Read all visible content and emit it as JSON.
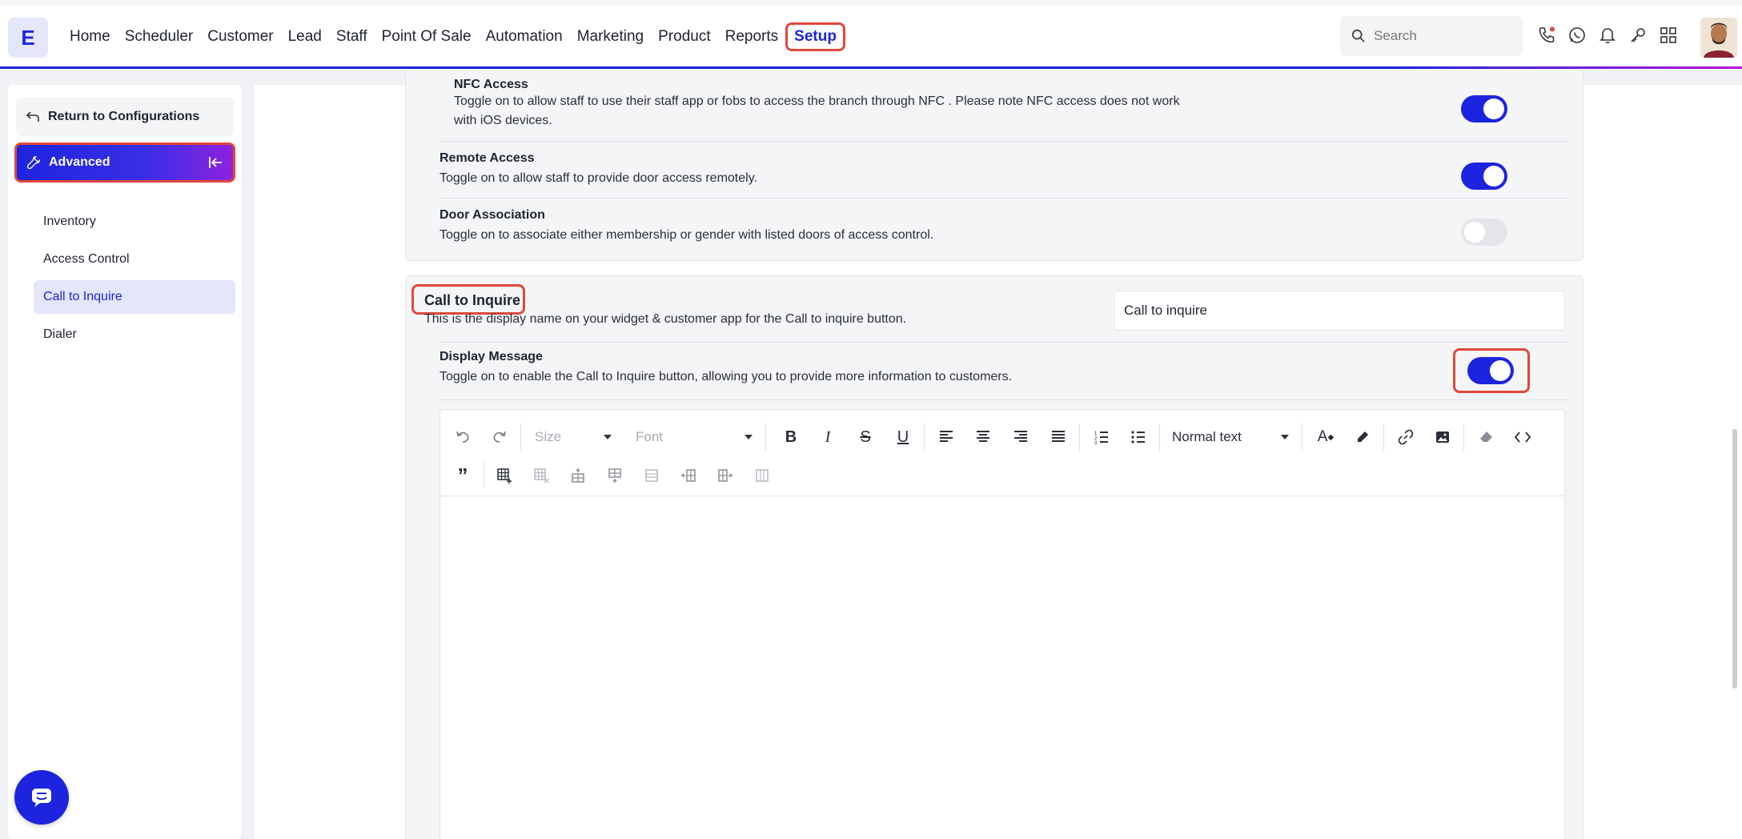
{
  "app": {
    "logo_letter": "E"
  },
  "nav": {
    "items": [
      "Home",
      "Scheduler",
      "Customer",
      "Lead",
      "Staff",
      "Point Of Sale",
      "Automation",
      "Marketing",
      "Product",
      "Reports",
      "Setup"
    ],
    "active": "Setup"
  },
  "search": {
    "placeholder": "Search"
  },
  "top_icons": [
    "phone-icon",
    "whatsapp-icon",
    "bell-icon",
    "key-icon",
    "apps-grid-icon"
  ],
  "colors": {
    "accent": "#1d24e0",
    "highlight": "#e0483a",
    "toggle_off": "#e4e5e9"
  },
  "sidebar": {
    "return_label": "Return to Configurations",
    "section_label": "Advanced",
    "items": [
      {
        "label": "Inventory",
        "active": false
      },
      {
        "label": "Access Control",
        "active": false
      },
      {
        "label": "Call to Inquire",
        "active": true
      },
      {
        "label": "Dialer",
        "active": false
      }
    ]
  },
  "access_control": {
    "nfc": {
      "title": "NFC Access",
      "desc_line1": "Toggle on to allow staff to use their staff app or fobs to access the branch through NFC . Please note NFC access does not work",
      "desc_line2": "with iOS devices.",
      "enabled": true
    },
    "remote": {
      "title": "Remote Access",
      "desc": "Toggle on to allow staff to provide door access remotely.",
      "enabled": true
    },
    "door": {
      "title": "Door Association",
      "desc": "Toggle on to associate either membership or gender with listed doors of access control.",
      "enabled": false
    }
  },
  "call_to_inquire": {
    "title": "Call to Inquire",
    "desc": "This is the display name on your widget & customer app for the Call to inquire button.",
    "display_name_value": "Call to inquire",
    "display_message": {
      "title": "Display Message",
      "desc": "Toggle on to enable the Call to Inquire button, allowing you to provide more information to customers.",
      "enabled": true
    }
  },
  "editor": {
    "size_placeholder": "Size",
    "font_placeholder": "Font",
    "block_format": "Normal text",
    "content": ""
  }
}
